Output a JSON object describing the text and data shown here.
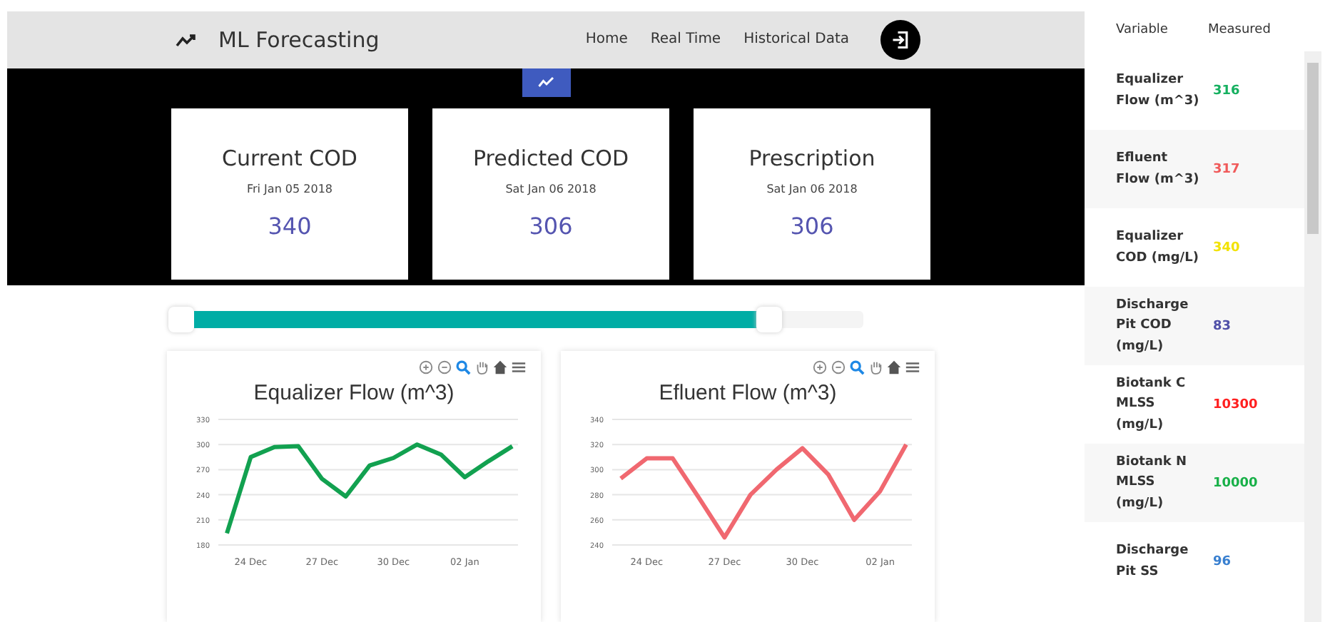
{
  "header": {
    "title": "ML Forecasting",
    "nav": [
      {
        "label": "Home"
      },
      {
        "label": "Real Time"
      },
      {
        "label": "Historical Data"
      }
    ]
  },
  "cards": [
    {
      "title": "Current COD",
      "date": "Fri Jan 05 2018",
      "value": "340"
    },
    {
      "title": "Predicted COD",
      "date": "Sat Jan 06 2018",
      "value": "306"
    },
    {
      "title": "Prescription",
      "date": "Sat Jan 06 2018",
      "value": "306"
    }
  ],
  "slider": {
    "level": 0.86
  },
  "charts": [
    {
      "chart_data": {
        "type": "line",
        "title": "Equalizer Flow (m^3)",
        "grid": true,
        "categories": [
          null,
          "24 Dec",
          null,
          null,
          "27 Dec",
          null,
          null,
          "30 Dec",
          null,
          null,
          "02 Jan",
          null,
          null
        ],
        "series": [
          {
            "color": "#12a150",
            "values": [
              194,
              285,
              297,
              298,
              259,
              238,
              275,
              284,
              300,
              288,
              261,
              280,
              298
            ]
          }
        ],
        "ylim": [
          180,
          330
        ],
        "yticks": [
          180,
          210,
          240,
          270,
          300,
          330
        ]
      }
    },
    {
      "chart_data": {
        "type": "line",
        "title": "Efluent Flow (m^3)",
        "grid": true,
        "categories": [
          null,
          "24 Dec",
          null,
          null,
          "27 Dec",
          null,
          null,
          "30 Dec",
          null,
          null,
          "02 Jan",
          null
        ],
        "series": [
          {
            "color": "#f06870",
            "values": [
              293,
              309,
              309,
              278,
              246,
              280,
              300,
              317,
              296,
              260,
              283,
              320
            ]
          }
        ],
        "ylim": [
          240,
          340
        ],
        "yticks": [
          240,
          260,
          280,
          300,
          320,
          340
        ]
      }
    }
  ],
  "table": {
    "columns": [
      "Variable",
      "Measured"
    ],
    "rows": [
      {
        "variable": "Equalizer Flow (m^3)",
        "measured": "316",
        "color": "#16b060"
      },
      {
        "variable": "Efluent Flow (m^3)",
        "measured": "317",
        "color": "#f05a5a"
      },
      {
        "variable": "Equalizer COD (mg/L)",
        "measured": "340",
        "color": "#f2e200"
      },
      {
        "variable": "Discharge Pit COD (mg/L)",
        "measured": "83",
        "color": "#5050a8"
      },
      {
        "variable": "Biotank C MLSS (mg/L)",
        "measured": "10300",
        "color": "#ff2020"
      },
      {
        "variable": "Biotank N MLSS (mg/L)",
        "measured": "10000",
        "color": "#18b048"
      },
      {
        "variable": "Discharge Pit SS",
        "measured": "96",
        "color": "#3a80d0"
      }
    ]
  }
}
